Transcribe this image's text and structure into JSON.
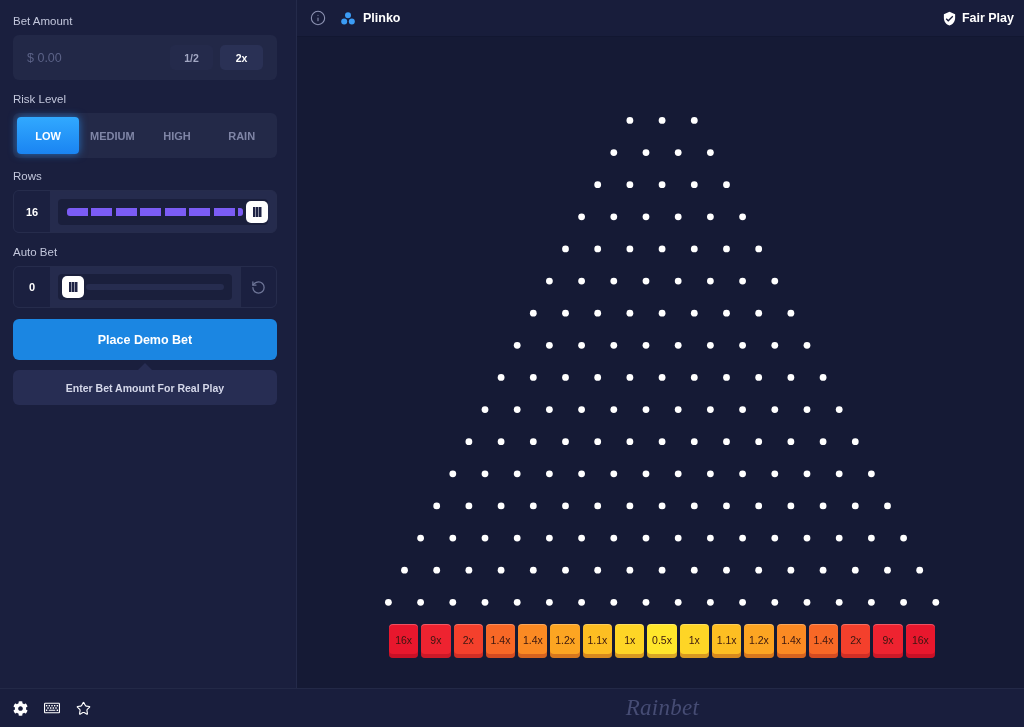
{
  "sidebar": {
    "bet_amount": {
      "label": "Bet Amount",
      "placeholder": "$ 0.00",
      "buttons": [
        {
          "label": "1/2",
          "active": false
        },
        {
          "label": "2x",
          "active": true
        }
      ]
    },
    "risk_level": {
      "label": "Risk Level",
      "options": [
        {
          "label": "LOW",
          "selected": true
        },
        {
          "label": "MEDIUM",
          "selected": false
        },
        {
          "label": "HIGH",
          "selected": false
        },
        {
          "label": "RAIN",
          "selected": false
        }
      ]
    },
    "rows": {
      "label": "Rows",
      "value": "16",
      "kind": "segmented",
      "reset": false,
      "level": 1
    },
    "auto_bet": {
      "label": "Auto Bet",
      "value": "0",
      "kind": "plain",
      "reset": true,
      "level": 0
    },
    "place_bet_button": "Place Demo Bet",
    "tooltip": "Enter Bet Amount For Real Play"
  },
  "header": {
    "game_title": "Plinko",
    "fair_play": "Fair Play"
  },
  "board": {
    "multipliers": [
      {
        "label": "16x",
        "color": "#e8172d"
      },
      {
        "label": "9x",
        "color": "#ee2330"
      },
      {
        "label": "2x",
        "color": "#f4402c"
      },
      {
        "label": "1.4x",
        "color": "#f86826"
      },
      {
        "label": "1.4x",
        "color": "#fb8a23"
      },
      {
        "label": "1.2x",
        "color": "#fca522"
      },
      {
        "label": "1.1x",
        "color": "#fdbe22"
      },
      {
        "label": "1x",
        "color": "#fed526"
      },
      {
        "label": "0.5x",
        "color": "#ffe62b"
      },
      {
        "label": "1x",
        "color": "#fed526"
      },
      {
        "label": "1.1x",
        "color": "#fdbe22"
      },
      {
        "label": "1.2x",
        "color": "#fca522"
      },
      {
        "label": "1.4x",
        "color": "#fb8a23"
      },
      {
        "label": "1.4x",
        "color": "#f86826"
      },
      {
        "label": "2x",
        "color": "#f4402c"
      },
      {
        "label": "9x",
        "color": "#ee2330"
      },
      {
        "label": "16x",
        "color": "#e8172d"
      }
    ]
  },
  "footer": {
    "logo": "Rainbet"
  }
}
